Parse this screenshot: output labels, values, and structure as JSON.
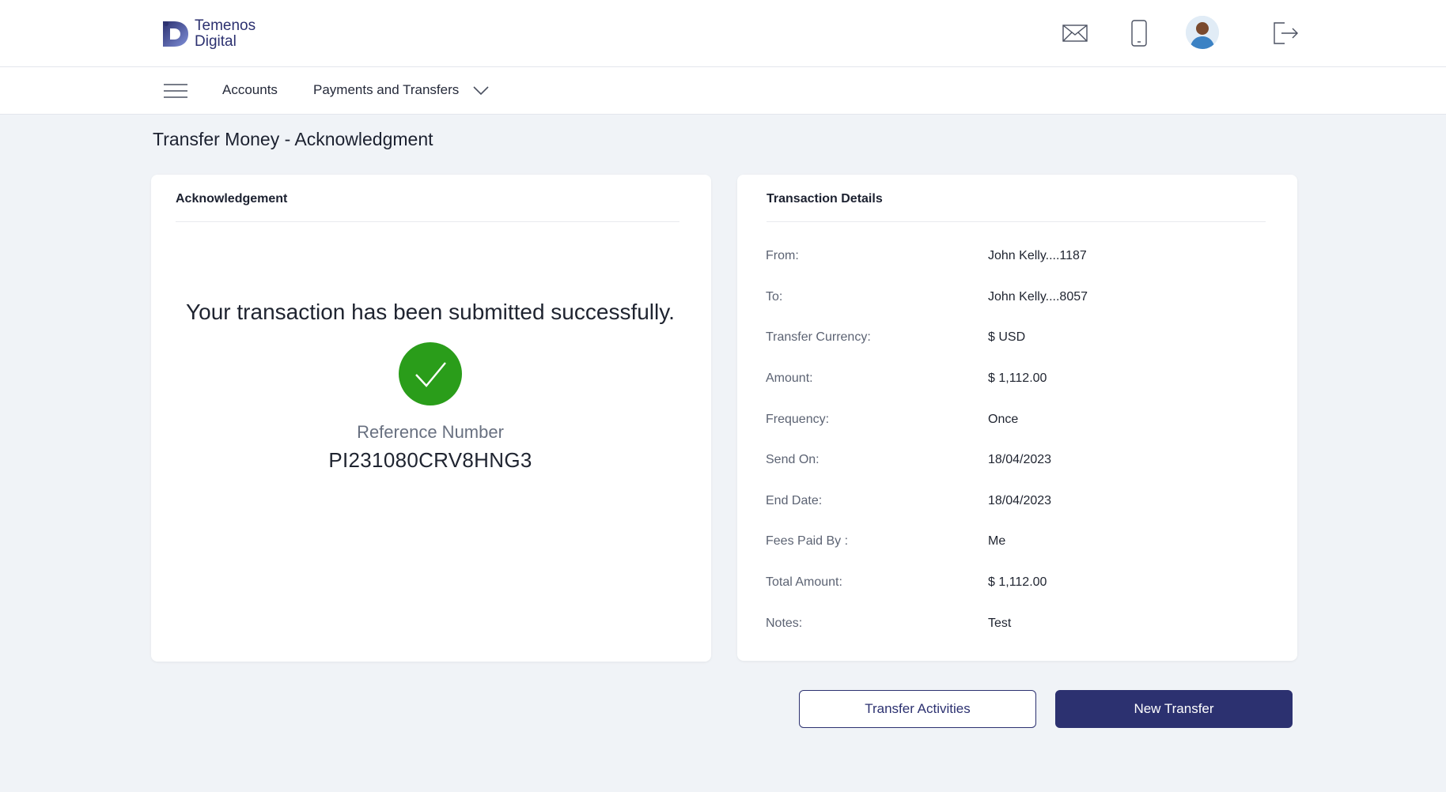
{
  "brand": {
    "logo_line1": "Temenos",
    "logo_line2": "Digital",
    "primary_color": "#2c3170",
    "success_color": "#2a9d1a"
  },
  "header": {
    "icons": [
      "mail-icon",
      "mobile-phone-icon",
      "user-avatar",
      "logout-icon"
    ]
  },
  "nav": {
    "items": [
      {
        "label": "Accounts"
      },
      {
        "label": "Payments and Transfers"
      }
    ]
  },
  "page": {
    "title": "Transfer Money - Acknowledgment"
  },
  "acknowledgement": {
    "title": "Acknowledgement",
    "message": "Your transaction has been submitted successfully.",
    "reference_label": "Reference Number",
    "reference_number": "PI231080CRV8HNG3"
  },
  "transaction_details": {
    "title": "Transaction Details",
    "rows": [
      {
        "label": "From:",
        "value": "John Kelly....1187"
      },
      {
        "label": "To:",
        "value": "John Kelly....8057"
      },
      {
        "label": "Transfer Currency:",
        "value": "$ USD"
      },
      {
        "label": "Amount:",
        "value": "$ 1,112.00"
      },
      {
        "label": "Frequency:",
        "value": "Once"
      },
      {
        "label": "Send On:",
        "value": "18/04/2023"
      },
      {
        "label": "End Date:",
        "value": "18/04/2023"
      },
      {
        "label": "Fees Paid By :",
        "value": "Me"
      },
      {
        "label": "Total Amount:",
        "value": "$ 1,112.00"
      },
      {
        "label": "Notes:",
        "value": "Test"
      }
    ]
  },
  "actions": {
    "secondary_label": "Transfer Activities",
    "primary_label": "New Transfer"
  }
}
